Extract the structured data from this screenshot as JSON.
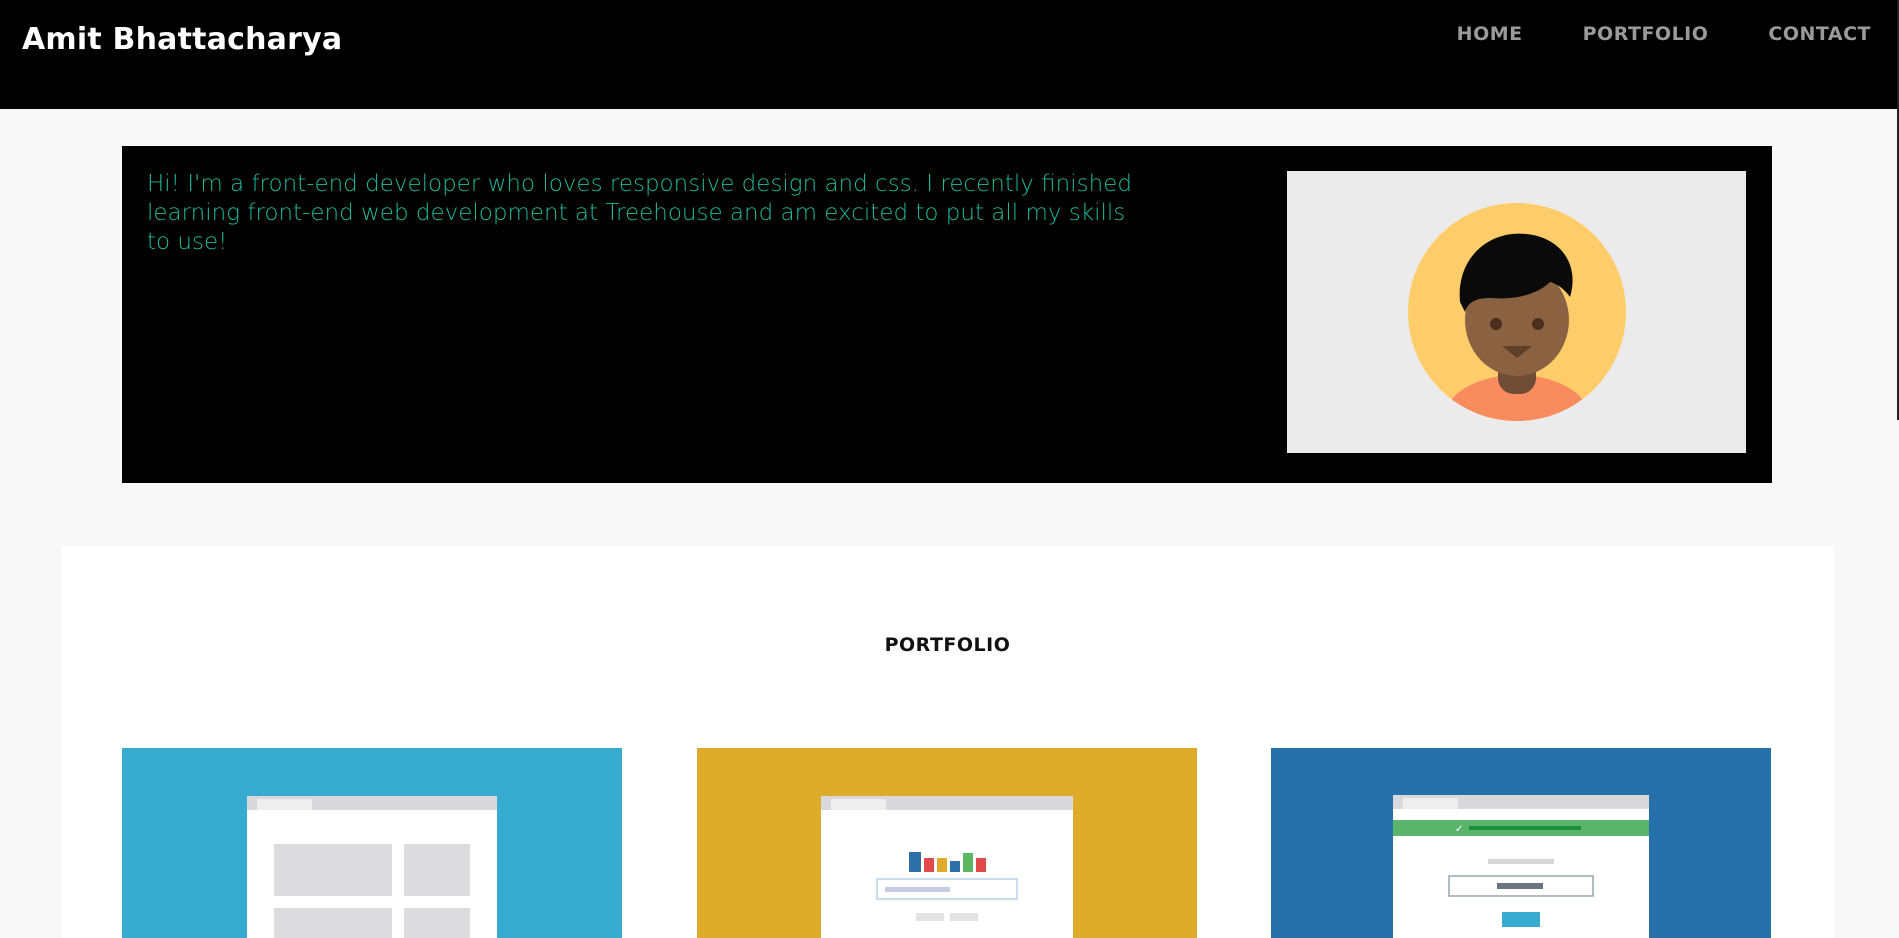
{
  "header": {
    "brand": "Amit Bhattacharya",
    "nav": [
      {
        "label": "HOME"
      },
      {
        "label": "PORTFOLIO"
      },
      {
        "label": "CONTACT"
      }
    ]
  },
  "hero": {
    "intro": "Hi! I'm a front-end developer who loves responsive design and css. I recently finished learning front-end web development at Treehouse and am excited to put all my skills to use!",
    "avatar_icon": "avatar-illustration"
  },
  "portfolio": {
    "title": "PORTFOLIO",
    "projects": [
      {
        "thumbnail": "layout-grid-thumbnail",
        "color": "#38abd1"
      },
      {
        "thumbnail": "bar-chart-form-thumbnail",
        "color": "#dfab2b"
      },
      {
        "thumbnail": "signup-form-thumbnail",
        "color": "#2671aa"
      }
    ]
  },
  "colors": {
    "header_bg": "#000000",
    "hero_text": "#1fb99a",
    "nav_text": "#9a9a9a",
    "page_bg": "#f8f8f8"
  }
}
